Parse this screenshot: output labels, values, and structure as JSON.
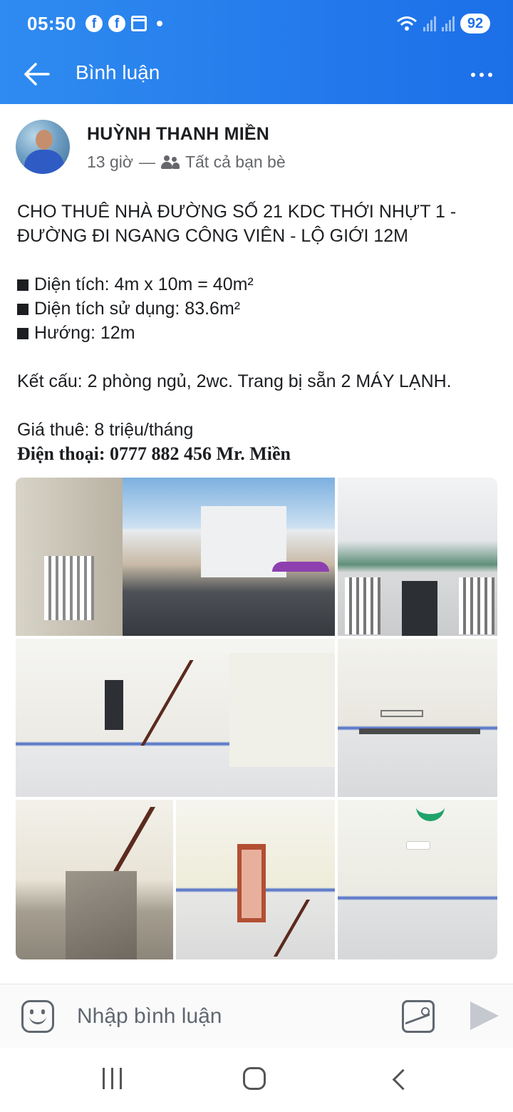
{
  "status_bar": {
    "time": "05:50",
    "battery": "92",
    "notification_icons": [
      "facebook-icon",
      "facebook-icon",
      "calendar-icon",
      "dot-icon"
    ]
  },
  "app_bar": {
    "title": "Bình luận",
    "back_icon": "arrow-left-icon",
    "more_icon": "more-horizontal-icon"
  },
  "post": {
    "author": "HUỲNH THANH MIỀN",
    "time": "13 giờ",
    "separator": "—",
    "audience": "Tất cả bạn bè",
    "lines": {
      "headline_1": "CHO THUÊ NHÀ ĐƯỜNG SỐ 21 KDC THỚI NHỰT 1 -",
      "headline_2": "ĐƯỜNG ĐI NGANG CÔNG VIÊN - LỘ GIỚI 12M",
      "area": "Diện tích: 4m x 10m = 40m²",
      "usable_area": "Diện tích sử dụng: 83.6m²",
      "direction": "Hướng: 12m",
      "structure": "Kết cấu: 2 phòng ngủ, 2wc. Trang bị sẵn 2 MÁY LẠNH.",
      "price": "Giá thuê: 8 triệu/tháng",
      "phone_label": "Điện thoại: 0777 882 456 Mr. Miền"
    },
    "photo_count": 7
  },
  "comment_bar": {
    "placeholder": "Nhập bình luận"
  },
  "colors": {
    "header_blue": "#1f73ea",
    "text": "#1c1e21",
    "secondary_text": "#65676b"
  }
}
